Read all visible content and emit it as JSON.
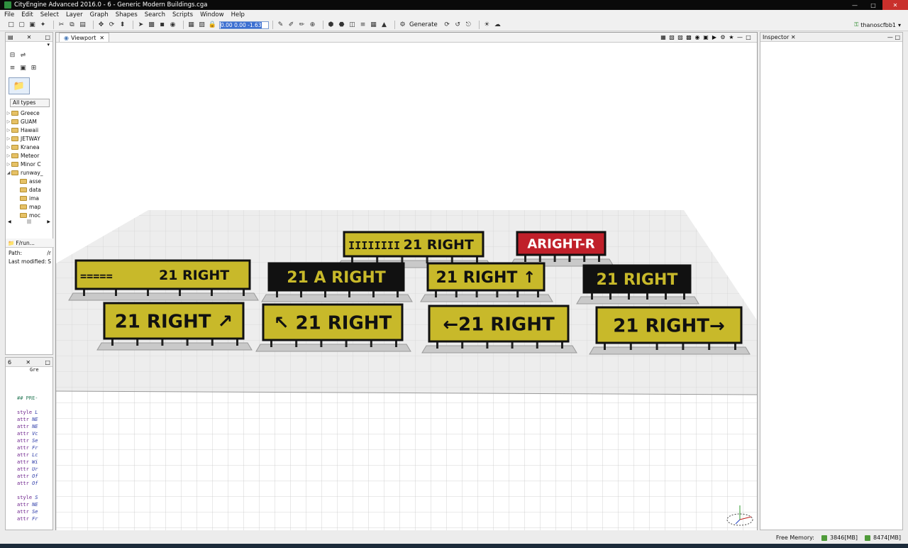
{
  "window": {
    "title": "CityEngine Advanced 2016.0 - 6 - Generic Modern Buildings.cga"
  },
  "menu": [
    "File",
    "Edit",
    "Select",
    "Layer",
    "Graph",
    "Shapes",
    "Search",
    "Scripts",
    "Window",
    "Help"
  ],
  "toolbar": {
    "coord_value": "0.00 0.00 -1.63",
    "generate_label": "Generate",
    "user": "thanoscfbb1"
  },
  "navigator": {
    "filter": "All types",
    "items": [
      {
        "label": "Greece",
        "child": false,
        "expanded": false
      },
      {
        "label": "GUAM",
        "child": false,
        "expanded": false
      },
      {
        "label": "Hawaii",
        "child": false,
        "expanded": false
      },
      {
        "label": "JETWAY",
        "child": false,
        "expanded": false
      },
      {
        "label": "Kranea",
        "child": false,
        "expanded": false
      },
      {
        "label": "Meteor",
        "child": false,
        "expanded": false
      },
      {
        "label": "Minor C",
        "child": false,
        "expanded": false
      },
      {
        "label": "runway_",
        "child": false,
        "expanded": true
      },
      {
        "label": "asse",
        "child": true,
        "expanded": false
      },
      {
        "label": "data",
        "child": true,
        "expanded": false
      },
      {
        "label": "ima",
        "child": true,
        "expanded": false
      },
      {
        "label": "map",
        "child": true,
        "expanded": false
      },
      {
        "label": "moc",
        "child": true,
        "expanded": false
      }
    ]
  },
  "properties": {
    "tab": "F/run...",
    "path_label": "Path:",
    "path_value": "/r",
    "modified_label": "Last modified:",
    "modified_value": "S"
  },
  "code": {
    "tab": "6",
    "first": "Gre",
    "lines": [
      {
        "kw": "",
        "it": "",
        "cm": ""
      },
      {
        "kw": "",
        "it": "",
        "cm": ""
      },
      {
        "kw": "",
        "it": "",
        "cm": ""
      },
      {
        "kw": "",
        "it": "",
        "cm": "## PRE-"
      },
      {
        "kw": "",
        "it": "",
        "cm": ""
      },
      {
        "kw": "style ",
        "it": "L",
        "cm": ""
      },
      {
        "kw": "attr ",
        "it": "NE",
        "cm": ""
      },
      {
        "kw": "attr ",
        "it": "NE",
        "cm": ""
      },
      {
        "kw": "attr ",
        "it": "Vc",
        "cm": ""
      },
      {
        "kw": "attr ",
        "it": "Se",
        "cm": ""
      },
      {
        "kw": "attr ",
        "it": "Fr",
        "cm": ""
      },
      {
        "kw": "attr ",
        "it": "Lc",
        "cm": ""
      },
      {
        "kw": "attr ",
        "it": "Wi",
        "cm": ""
      },
      {
        "kw": "attr ",
        "it": "Ur",
        "cm": ""
      },
      {
        "kw": "attr ",
        "it": "Of",
        "cm": ""
      },
      {
        "kw": "attr ",
        "it": "Of",
        "cm": ""
      },
      {
        "kw": "",
        "it": "",
        "cm": ""
      },
      {
        "kw": "style ",
        "it": "S",
        "cm": ""
      },
      {
        "kw": "attr ",
        "it": "NE",
        "cm": ""
      },
      {
        "kw": "attr ",
        "it": "Se",
        "cm": ""
      },
      {
        "kw": "attr ",
        "it": "Fr",
        "cm": ""
      }
    ]
  },
  "viewport": {
    "tab": "Viewport",
    "signs": [
      {
        "text": "21 RIGHT",
        "style": "yellow",
        "prefix": "IIIIIIII"
      },
      {
        "text": "ARIGHT-R",
        "style": "red",
        "prefix": ""
      },
      {
        "text": "21 RIGHT",
        "style": "yellow",
        "prefix": "====="
      },
      {
        "text": "21 A RIGHT",
        "style": "black",
        "prefix": ""
      },
      {
        "text": "21 RIGHT ↑",
        "style": "yellow",
        "prefix": ""
      },
      {
        "text": "21 RIGHT",
        "style": "black",
        "prefix": ""
      },
      {
        "text": "21 RIGHT ↗",
        "style": "yellow",
        "prefix": ""
      },
      {
        "text": "↖ 21 RIGHT",
        "style": "yellow",
        "prefix": ""
      },
      {
        "text": "←21 RIGHT",
        "style": "yellow",
        "prefix": ""
      },
      {
        "text": "21 RIGHT→",
        "style": "yellow",
        "prefix": ""
      }
    ]
  },
  "inspector": {
    "tab": "Inspector"
  },
  "status": {
    "free_memory_label": "Free Memory:",
    "mem1": "3846[MB]",
    "mem2": "8474[MB]"
  },
  "colors": {
    "sign_yellow": "#c8b92a",
    "sign_red": "#c0202a",
    "sign_black": "#111111"
  }
}
